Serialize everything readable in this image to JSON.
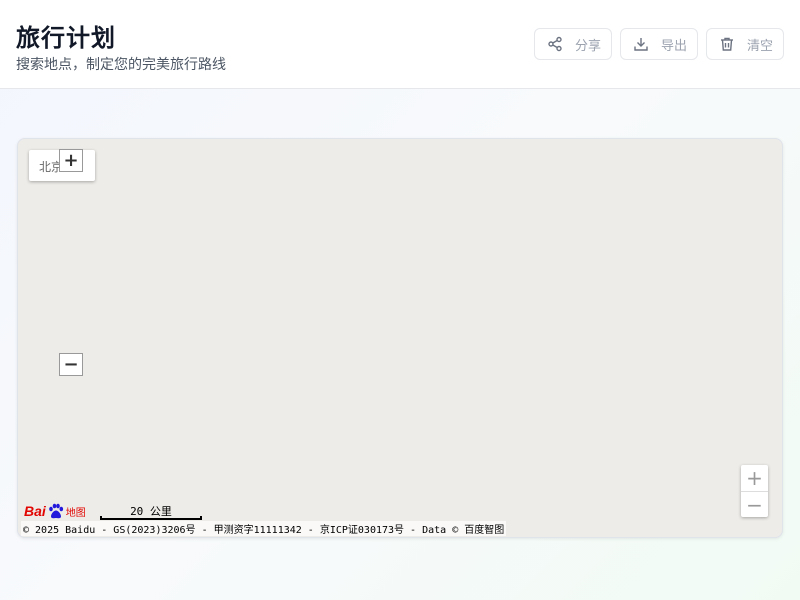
{
  "header": {
    "title": "旅行计划",
    "subtitle": "搜索地点，制定您的完美旅行路线",
    "buttons": {
      "share": "分享",
      "export": "导出",
      "clear": "清空"
    }
  },
  "map": {
    "city": "北京",
    "zoom_in": "+",
    "zoom_out": "−",
    "logo_bai": "Bai",
    "logo_map": "地图",
    "scale_label": "20 公里",
    "copyright": "© 2025 Baidu - GS(2023)3206号 - 甲测资字11111342 - 京ICP证030173号 - Data © 百度智图"
  },
  "icons": {
    "share": "share-icon",
    "export": "download-icon",
    "clear": "trash-icon"
  },
  "colors": {
    "map_background": "#eeece8",
    "title": "#111827",
    "button_text": "#9ca3af",
    "baidu_red": "#e10602",
    "baidu_blue": "#2319dc"
  }
}
